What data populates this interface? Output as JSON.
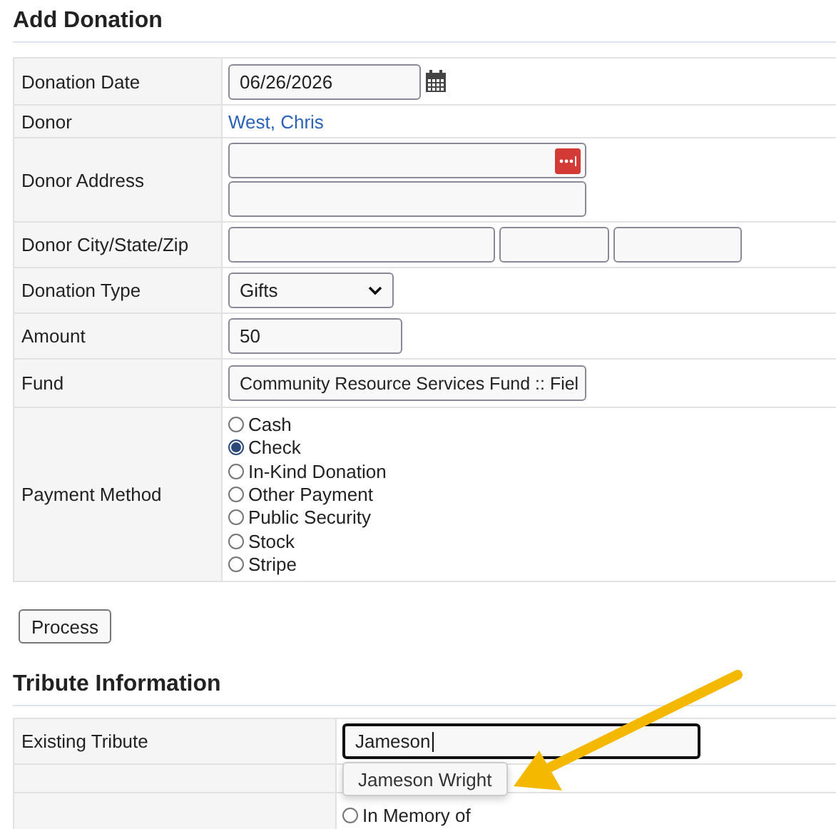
{
  "donation": {
    "title": "Add Donation",
    "rows": [
      {
        "label": "Donation Date",
        "kind": "date",
        "value": "06/26/2026"
      },
      {
        "label": "Donor",
        "kind": "link",
        "value": "West, Chris"
      },
      {
        "label": "Donor Address",
        "kind": "address"
      },
      {
        "label": "Donor City/State/Zip",
        "kind": "citystatezip"
      },
      {
        "label": "Donation Type",
        "kind": "select",
        "value": "Gifts"
      },
      {
        "label": "Amount",
        "kind": "text",
        "value": "50"
      },
      {
        "label": "Fund",
        "kind": "wide",
        "value": "Community Resource Services Fund :: Fiel"
      },
      {
        "label": "Payment Method",
        "kind": "radio",
        "options": [
          {
            "label": "Cash",
            "selected": false
          },
          {
            "label": "Check",
            "selected": true
          },
          {
            "label": "In-Kind Donation",
            "selected": false
          },
          {
            "label": "Other Payment",
            "selected": false
          },
          {
            "label": "Public Security",
            "selected": false
          },
          {
            "label": "Stock",
            "selected": false
          },
          {
            "label": "Stripe",
            "selected": false
          }
        ]
      }
    ]
  },
  "process_button": "Process",
  "tribute": {
    "title": "Tribute Information",
    "rows": [
      {
        "label": "Existing Tribute",
        "kind": "search",
        "value": "Jameson",
        "suggestions": [
          "Jameson Wright"
        ]
      },
      {
        "kind": "blank"
      },
      {
        "kind": "radio",
        "options": [
          {
            "label": "In Memory of",
            "selected": false
          }
        ]
      }
    ]
  }
}
